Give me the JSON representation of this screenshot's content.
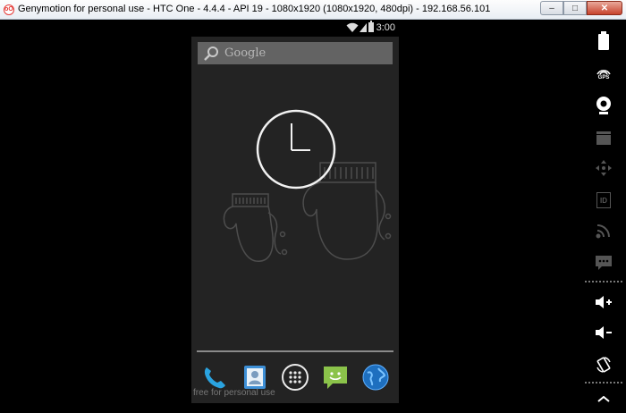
{
  "window": {
    "title": "Genymotion for personal use - HTC One - 4.4.4 - API 19 - 1080x1920 (1080x1920, 480dpi) - 192.168.56.101",
    "app_icon_text": "oO",
    "minimize_symbol": "–",
    "maximize_symbol": "□",
    "close_symbol": "✕"
  },
  "android": {
    "status_bar": {
      "time": "3:00"
    },
    "search": {
      "label": "Google"
    },
    "watermark": "free for personal use",
    "dock": [
      "phone-icon",
      "contacts-icon",
      "app-drawer-icon",
      "messaging-icon",
      "browser-icon"
    ]
  },
  "toolbar": {
    "gps_label": "GPS",
    "id_label": "ID",
    "tools": [
      "battery-icon",
      "gps-icon",
      "webcam-icon",
      "capture-icon",
      "remote-control-icon",
      "identifiers-icon",
      "network-icon",
      "sms-icon",
      "volume-up-icon",
      "volume-down-icon",
      "rotate-icon"
    ]
  },
  "colors": {
    "close_button": "#c7432c",
    "screen_bg": "#232323",
    "search_bg": "#6a6a6a"
  }
}
